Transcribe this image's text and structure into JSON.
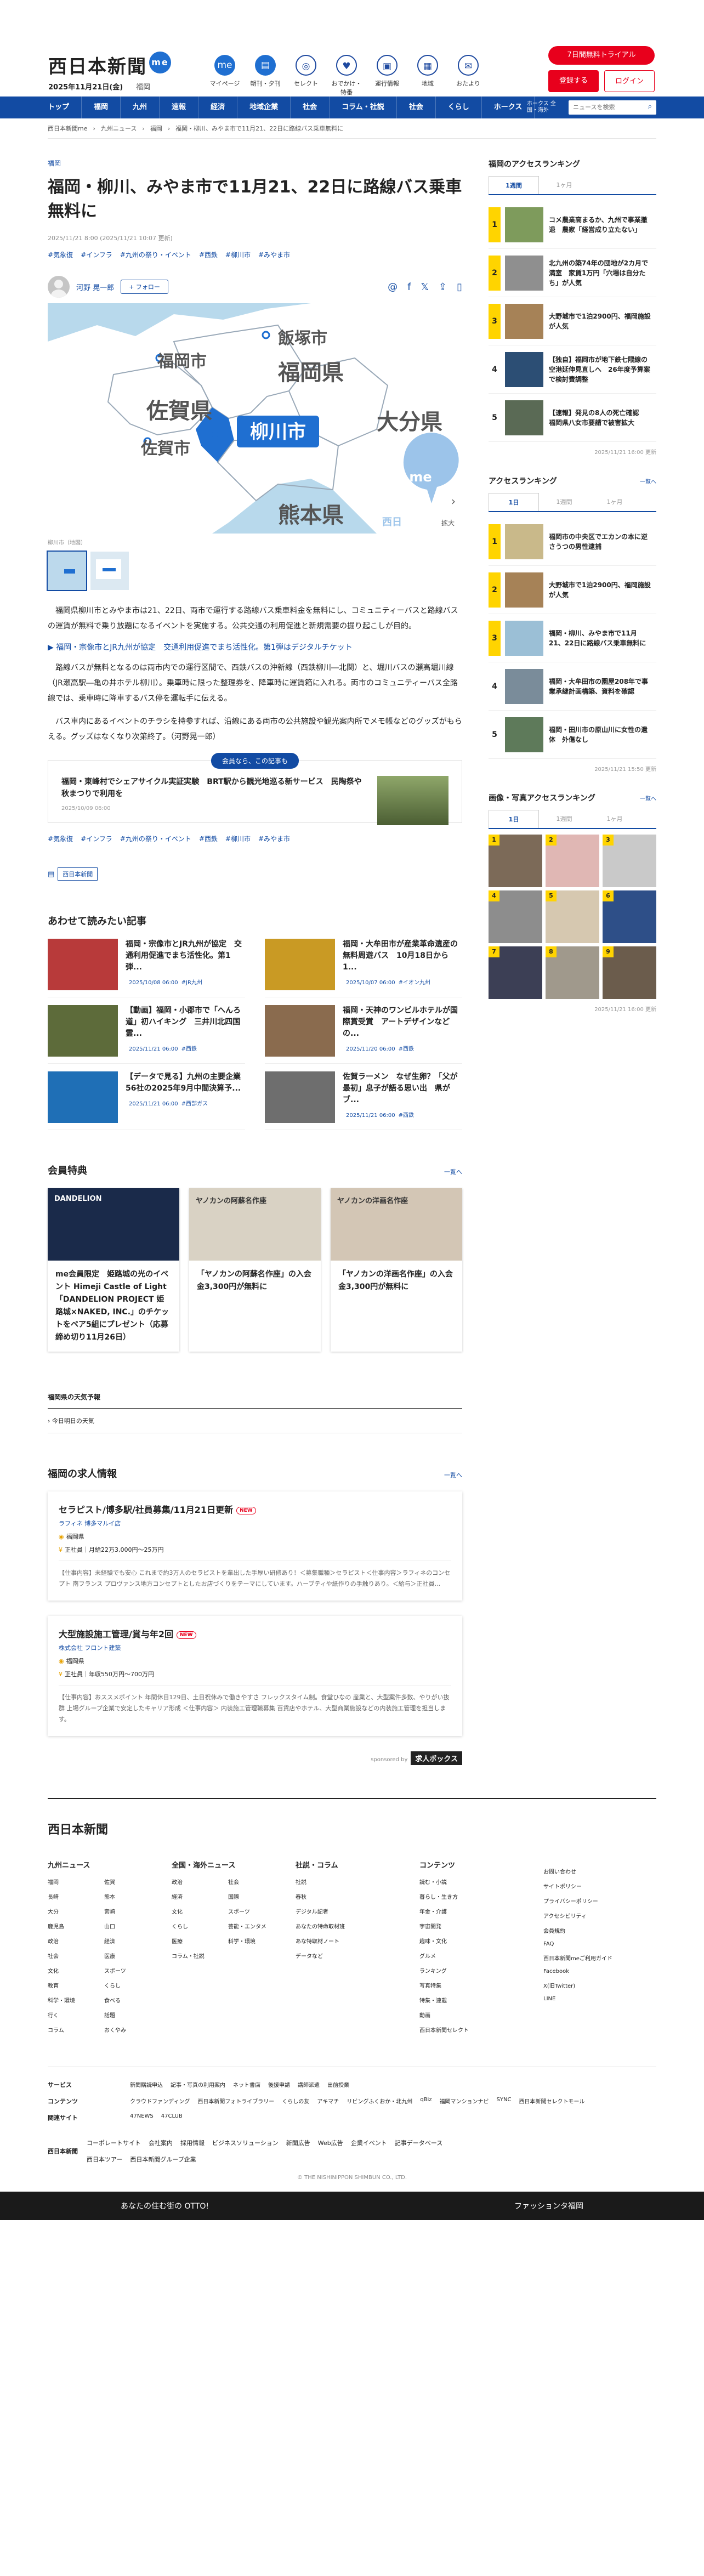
{
  "brand": {
    "logo": "西日本新聞",
    "me": "me",
    "date": "2025年11月21日(金)",
    "region": "福岡"
  },
  "header_icons": [
    {
      "label": "マイページ",
      "glyph": "me"
    },
    {
      "label": "朝刊・夕刊",
      "glyph": "▤"
    },
    {
      "label": "セレクト",
      "glyph": "◎"
    },
    {
      "label": "おでかけ・特番",
      "glyph": "♥"
    },
    {
      "label": "運行情報",
      "glyph": "▣"
    },
    {
      "label": "地域",
      "glyph": "▦"
    },
    {
      "label": "おたより",
      "glyph": "✉"
    }
  ],
  "trial_label": "7日間無料トライアル",
  "register_label": "登録する",
  "login_label": "ログイン",
  "nav": [
    "トップ",
    "福岡",
    "九州",
    "速報",
    "経済",
    "地域企業",
    "社会",
    "コラム・社説",
    "社会",
    "くらし",
    "ホークス"
  ],
  "nav_small": "ホークス 全国・海外",
  "search_placeholder": "ニュースを検索",
  "breadcrumb": [
    "西日本新聞me",
    "九州ニュース",
    "福岡",
    "福岡・柳川、みやま市で11月21、22日に路線バス乗車無料に"
  ],
  "article": {
    "category": "福岡",
    "title": "福岡・柳川、みやま市で11月21、22日に路線バス乗車無料に",
    "pubdate": "2025/11/21 8:00 (2025/11/21 10:07 更新)",
    "tags": [
      "#気象復",
      "#インフラ",
      "#九州の祭り・イベント",
      "#西鉄",
      "#柳川市",
      "#みやま市"
    ],
    "author": "河野 晃一郎",
    "follow": "+ フォロー",
    "map": {
      "fukuoka_city": "福岡市",
      "iizuka": "飯塚市",
      "fukuoka_pref": "福岡県",
      "saga_pref": "佐賀県",
      "saga_city": "佐賀市",
      "yanagawa": "柳川市",
      "oita": "大分県",
      "kumamoto": "熊本県",
      "me": "me",
      "nishi": "西日",
      "enlarge": "拡大"
    },
    "caption": "柳川市（地図）",
    "paragraphs": [
      "福岡県柳川市とみやま市は21、22日、両市で運行する路線バス乗車料金を無料にし、コミュニティーバスと路線バスの運賃が無料で乗り放題になるイベントを実施する。公共交通の利用促進と新規需要の掘り起こしが目的。",
      "路線バスが無料となるのは両市内での運行区間で、西鉄バスの沖新線（西鉄柳川―北関）と、堀川バスの瀬高堀川線（JR瀬高駅―亀の井ホテル柳川）。乗車時に限った整理券を、降車時に運賃箱に入れる。両市のコミュニティーバス全路線では、乗車時に降車するバス停を運転手に伝える。",
      "バス車内にあるイベントのチラシを持参すれば、沿線にある両市の公共施設や観光案内所でメモ帳などのグッズがもらえる。グッズはなくなり次第終了。（河野晃一郎）"
    ],
    "related_link": "▶ 福岡・宗像市とJR九州が協定　交通利用促進でまち活性化。第1弾はデジタルチケット",
    "promo_badge": "会員なら、この記事も",
    "promo_title": "福岡・東峰村でシェアサイクル実証実験　BRT駅から観光地巡る新サービス　民陶祭や秋まつりで利用を",
    "promo_date": "2025/10/09 06:00",
    "source": "西日本新聞"
  },
  "related_h": "あわせて読みたい記事",
  "related": [
    {
      "title": "福岡・宗像市とJR九州が協定　交通利用促進でまち活性化。第1弾...",
      "date": "2025/10/08 06:00",
      "tag": "#JR九州",
      "color": "#b83a3a"
    },
    {
      "title": "福岡・大牟田市が産業革命遺産の無料周遊バス　10月18日から1...",
      "date": "2025/10/07 06:00",
      "tag": "#イオン九州",
      "color": "#c99a24"
    },
    {
      "title": "【動画】福岡・小郡市で「へんろ道」初ハイキング　三井川北四国霊...",
      "date": "2025/11/21 06:00",
      "tag": "#西鉄",
      "color": "#5d6b3a"
    },
    {
      "title": "福岡・天神のワンビルホテルが国際賞受賞　アートデザインなどの...",
      "date": "2025/11/20 06:00",
      "tag": "#西鉄",
      "color": "#8a6b4e"
    },
    {
      "title": "【データで見る】九州の主要企業56社の2025年9月中間決算予...",
      "date": "2025/11/21 06:00",
      "tag": "#西部ガス",
      "color": "#1f6fb6"
    },
    {
      "title": "佐賀ラーメン　なぜ生卵？「父が最初」息子が語る思い出　県がブ...",
      "date": "2025/11/21 06:00",
      "tag": "#西鉄",
      "color": "#6e6e6e"
    }
  ],
  "benefits_h": "会員特典",
  "benefits_more": "一覧へ",
  "benefits": [
    {
      "title": "me会員限定　姫路城の光のイベント Himeji Castle of Light「DANDELION PROJECT 姫路城×NAKED, INC.」のチケットをペア5組にプレゼント（応募締め切り11月26日）",
      "img_text": "DANDELION",
      "color": "#1a2a4a"
    },
    {
      "title": "「ヤノカンの阿蘇名作座」の入会金3,300円が無料に",
      "img_text": "ヤノカンの阿蘇名作座",
      "color": "#d9d2c4"
    },
    {
      "title": "「ヤノカンの洋画名作座」の入会金3,300円が無料に",
      "img_text": "ヤノカンの洋画名作座",
      "color": "#d3c6b5"
    }
  ],
  "weather_h": "福岡県の天気予報",
  "weather_row": "今日明日の天気",
  "jobs_h": "福岡の求人情報",
  "jobs_more": "一覧へ",
  "jobs": [
    {
      "title": "セラピスト/博多駅/社員募集/11月21日更新",
      "new": "NEW",
      "company": "ラフィネ 博多マルイ店",
      "place": "福岡県",
      "pay": "正社員｜月給22万3,000円〜25万円",
      "desc": "【仕事内容】未経験でも安心 これまで約3万人のセラピストを輩出した手厚い研修あり！＜募集職種＞セラピスト＜仕事内容＞ラフィネのコンセプト 南フランス プロヴァンス地方コンセプトとしたお店づくりをテーマにしています。ハーブティや紙作りの手触りあり。＜給与＞正社員..."
    },
    {
      "title": "大型施設施工管理/賞与年2回",
      "new": "NEW",
      "company": "株式会社 フロント建築",
      "place": "福岡県",
      "pay": "正社員｜年収550万円〜700万円",
      "desc": "【仕事内容】おススメポイント 年間休日129日、土日祝休みで働きやすさ フレックスタイム制。食堂ひなの 産業と、大型案件多数、やりがい抜群 上場グループ企業で安定したキャリア形成 ＜仕事内容＞ 内装施工管理職募集 百貨店やホテル、大型商業施設などの内装施工管理を担当します。"
    }
  ],
  "sponsor": {
    "label": "sponsored by",
    "brand": "求人ボックス"
  },
  "side": {
    "ranking_h": "福岡のアクセスランキング",
    "tabs1": [
      "1週間",
      "1ヶ月"
    ],
    "ranks1": [
      {
        "n": "1",
        "title": "コメ農業高まるか、九州で事業撤退　農家「経営成り立たない」",
        "color": "#7e9b5c"
      },
      {
        "n": "2",
        "title": "北九州の築74年の団地が2カ月で満室　家賃1万円「穴場は自分たち」が人気",
        "color": "#8f8f8f"
      },
      {
        "n": "3",
        "title": "大野城市で1泊2900円、福岡施設が人気",
        "color": "#a68257"
      },
      {
        "n": "4",
        "title": "【独自】福岡市が地下鉄七隈線の空港延伸見直しへ　26年度予算案で検討費調整",
        "color": "#2c4e74"
      },
      {
        "n": "5",
        "title": "【速報】発見の8人の死亡確認　福岡県八女市要請で被害拡大",
        "color": "#5a6a55"
      }
    ],
    "date1": "2025/11/21 16:00 更新",
    "access_h": "アクセスランキング",
    "access_more": "一覧へ",
    "tabs2": [
      "1日",
      "1週間",
      "1ヶ月"
    ],
    "ranks2": [
      {
        "n": "1",
        "title": "福岡市の中央区でエカンの本に逆さうつの男性逮捕",
        "color": "#c9b98a"
      },
      {
        "n": "2",
        "title": "大野城市で1泊2900円、福岡施設が人気",
        "color": "#a68257"
      },
      {
        "n": "3",
        "title": "福岡・柳川、みやま市で11月21、22日に路線バス乗車無料に",
        "color": "#9bbfd6"
      },
      {
        "n": "4",
        "title": "福岡・大牟田市の園屋208年で事業承継計画構築、資料を確認",
        "color": "#7a8c9a"
      },
      {
        "n": "5",
        "title": "福岡・田川市の原山川に女性の遺体　外傷なし",
        "color": "#5e7a5a"
      }
    ],
    "date2": "2025/11/21 15:50 更新",
    "photo_h": "画像・写真アクセスランキング",
    "photo_more": "一覧へ",
    "tabs3": [
      "1日",
      "1週間",
      "1ヶ月"
    ],
    "photos": [
      {
        "n": "1",
        "color": "#7c6a58"
      },
      {
        "n": "2",
        "color": "#e0b7b4"
      },
      {
        "n": "3",
        "color": "#c9c9c9"
      },
      {
        "n": "4",
        "color": "#8d8d8d"
      },
      {
        "n": "5",
        "color": "#d6c8b0"
      },
      {
        "n": "6",
        "color": "#2e4f88"
      },
      {
        "n": "7",
        "color": "#3c3f55"
      },
      {
        "n": "8",
        "color": "#a0998c"
      },
      {
        "n": "9",
        "color": "#6b5c4c"
      }
    ],
    "date3": "2025/11/21 16:00 更新"
  },
  "footer": {
    "logo": "西日本新聞",
    "cols": [
      {
        "h": "九州ニュース",
        "items": [
          "福岡",
          "佐賀",
          "長崎",
          "熊本",
          "大分",
          "宮崎",
          "鹿児島",
          "山口",
          "政治",
          "経済",
          "社会",
          "医療",
          "文化",
          "スポーツ",
          "教育",
          "くらし",
          "科学・環境",
          "食べる",
          "行く",
          "話題",
          "コラム",
          "おくやみ"
        ]
      },
      {
        "h": "全国・海外ニュース",
        "items": [
          "政治",
          "社会",
          "経済",
          "国際",
          "文化",
          "スポーツ",
          "くらし",
          "芸能・エンタメ",
          "医療",
          "科学・環境",
          "コラム・社説"
        ]
      },
      {
        "h": "社説・コラム",
        "items": [
          "社説",
          "春秋",
          "デジタル記者",
          "あなたの特命取材班",
          "あな特取材ノート",
          "データなど"
        ]
      },
      {
        "h": "コンテンツ",
        "items": [
          "読む・小説",
          "暮らし・生き方",
          "年金・介護",
          "宇宙開発",
          "趣味・文化",
          "グルメ",
          "ランキング",
          "写真特集",
          "特集・連載",
          "動画",
          "西日本新聞セレクト"
        ]
      },
      {
        "h": "",
        "items": [
          "お問い合わせ",
          "サイトポリシー",
          "プライバシーポリシー",
          "アクセシビリティ",
          "会員規約",
          "FAQ",
          "西日本新聞meご利用ガイド",
          "Facebook",
          "X(旧Twitter)",
          "LINE"
        ]
      }
    ],
    "rows": [
      {
        "h": "サービス",
        "items": [
          "新聞購読申込",
          "記事・写真の利用案内",
          "ネット書店",
          "後援申請",
          "講師派遣",
          "出前授業"
        ]
      },
      {
        "h": "コンテンツ",
        "items": [
          "クラウドファンディング",
          "西日本新聞フォトライブラリー",
          "くらしの友",
          "アキマチ",
          "リビングふくおか・北九州",
          "qBiz",
          "福岡マンションナビ",
          "SYNC",
          "西日本新聞セレクトモール"
        ]
      },
      {
        "h": "関連サイト",
        "items": [
          "47NEWS",
          "47CLUB"
        ]
      }
    ],
    "corp": {
      "logo": "西日本新聞",
      "items": [
        "コーポレートサイト",
        "会社案内",
        "採用情報",
        "ビジネスソリューション",
        "新聞広告",
        "Web広告",
        "企業イベント",
        "記事データベース",
        "西日本ツアー",
        "西日本新聞グループ企業"
      ]
    },
    "copyright": "© THE NISHINIPPON SHIMBUN CO., LTD.",
    "ad": {
      "left": "あなたの住む街の OTTO!",
      "right": "ファッションタ福岡"
    }
  }
}
